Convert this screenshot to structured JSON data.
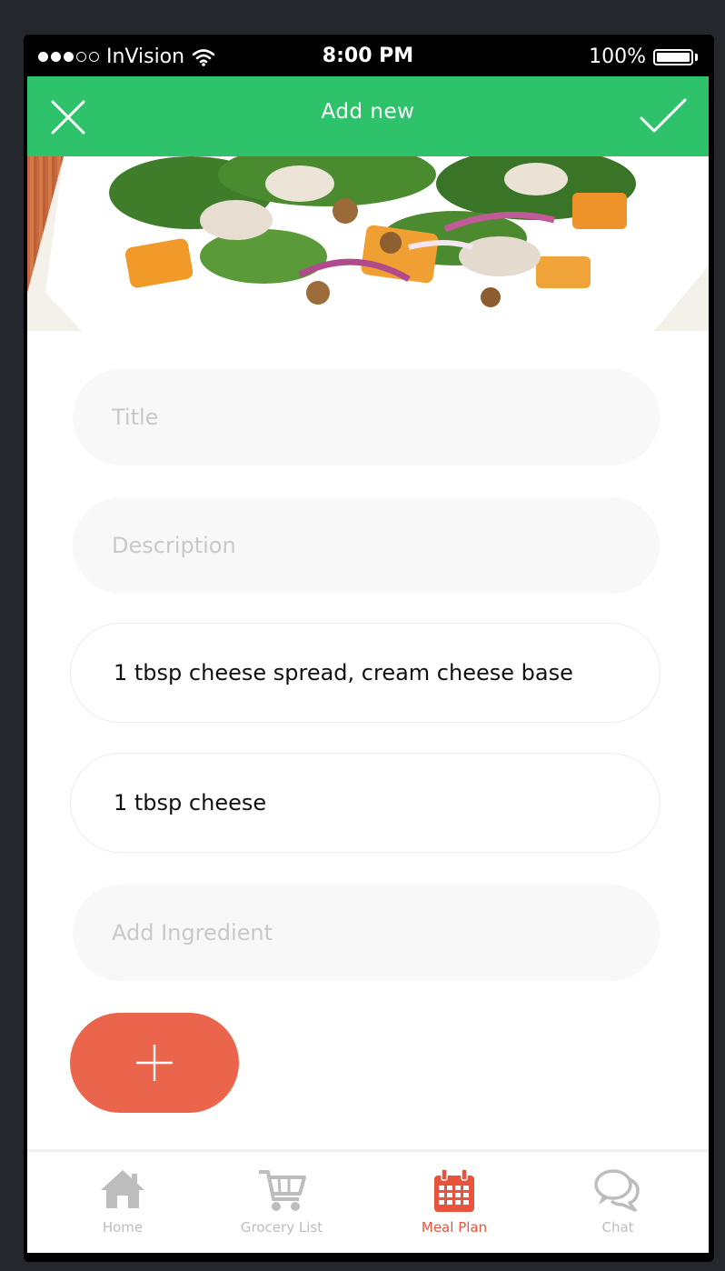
{
  "status_bar": {
    "carrier": "InVision",
    "time": "8:00 PM",
    "battery": "100%"
  },
  "app_bar": {
    "title": "Add new",
    "color": "#2ec36b"
  },
  "form": {
    "title_placeholder": "Title",
    "description_placeholder": "Description",
    "ingredients": [
      "1 tbsp cheese spread, cream cheese base",
      "1 tbsp cheese"
    ],
    "add_ingredient_placeholder": "Add Ingredient"
  },
  "add_button": {
    "color": "#ea654b",
    "icon": "plus-icon"
  },
  "tab_bar": {
    "active_color": "#e8533c",
    "tabs": [
      {
        "label": "Home",
        "icon": "home-icon"
      },
      {
        "label": "Grocery List",
        "icon": "cart-icon"
      },
      {
        "label": "Meal Plan",
        "icon": "calendar-icon",
        "active": true
      },
      {
        "label": "Chat",
        "icon": "chat-bubbles-icon"
      }
    ]
  }
}
